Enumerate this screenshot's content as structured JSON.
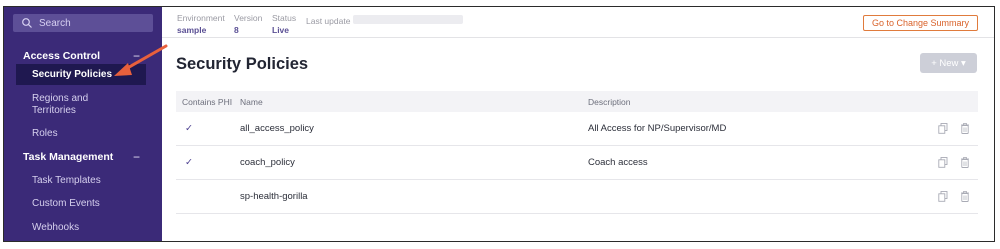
{
  "sidebar": {
    "search": {
      "placeholder": "Search"
    },
    "sections": [
      {
        "title": "Access Control",
        "toggle": "−",
        "items": [
          {
            "label": "Security Policies",
            "active": true
          },
          {
            "label": "Regions and Territories"
          },
          {
            "label": "Roles"
          }
        ]
      },
      {
        "title": "Task Management",
        "toggle": "−",
        "items": [
          {
            "label": "Task Templates"
          },
          {
            "label": "Custom Events"
          },
          {
            "label": "Webhooks"
          }
        ]
      }
    ]
  },
  "topbar": {
    "environment": {
      "label": "Environment",
      "value": "sample"
    },
    "version": {
      "label": "Version",
      "value": "8"
    },
    "status": {
      "label": "Status",
      "value": "Live"
    },
    "last_update": {
      "label": "Last update"
    },
    "summary_button": "Go to Change Summary"
  },
  "main": {
    "title": "Security Policies",
    "new_button": "+ New ▾",
    "columns": {
      "phi": "Contains PHI",
      "name": "Name",
      "description": "Description"
    },
    "rows": [
      {
        "phi": "✓",
        "name": "all_access_policy",
        "description": "All Access for NP/Supervisor/MD"
      },
      {
        "phi": "✓",
        "name": "coach_policy",
        "description": "Coach access"
      },
      {
        "phi": "",
        "name": "sp-health-gorilla",
        "description": ""
      }
    ]
  },
  "colors": {
    "sidebar_bg": "#3b2a78",
    "sidebar_active_bg": "#1f1850",
    "accent_orange": "#d9622a",
    "arrow": "#e8603c",
    "checkmark": "#4b3f8f"
  }
}
